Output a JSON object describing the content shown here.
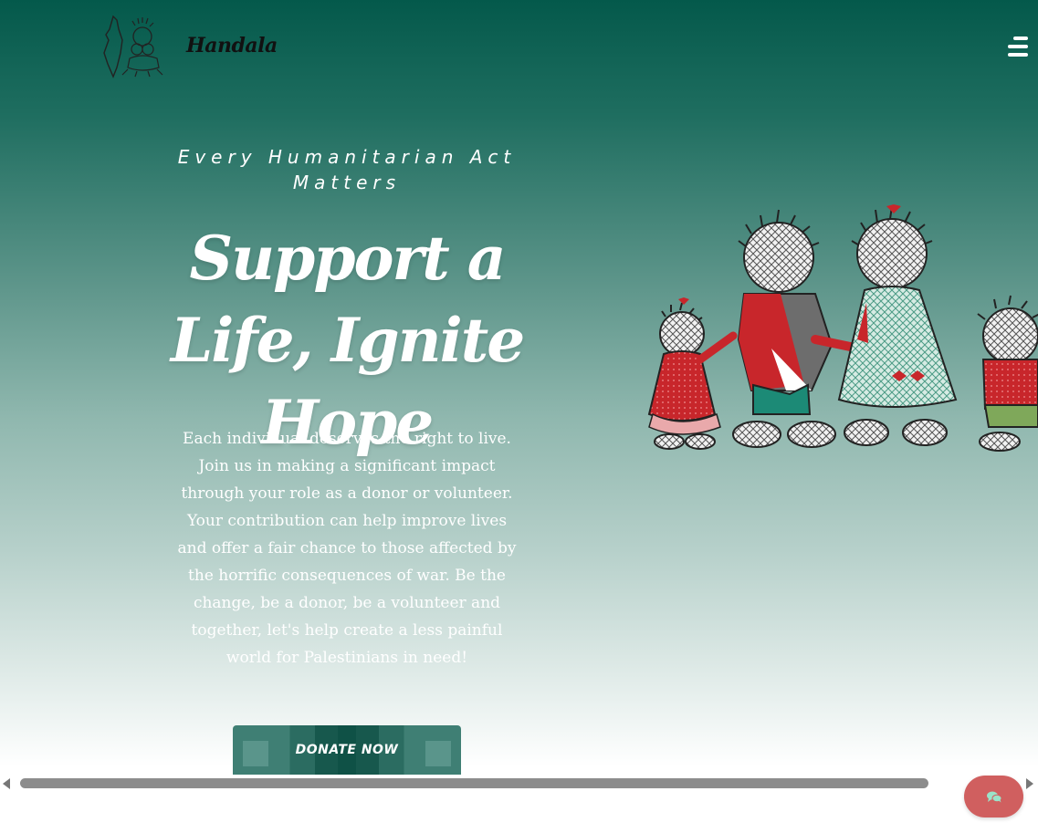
{
  "header": {
    "brand": "Handala",
    "logo_icon": "handala-map-logo-icon",
    "menu_icon": "hamburger-menu-icon"
  },
  "hero": {
    "tagline": "Every Humanitarian Act Matters",
    "headline": "Support a Life, Ignite Hope",
    "body": "Each individual deserves the right to live. Join us in making a significant impact through your role as a donor or volunteer. Your contribution can help improve lives and offer a fair chance to those affected by the horrific consequences of war. Be the change, be a donor, be a volunteer and together, let's help create a less painful world for Palestinians in need!",
    "donate_label": "DONATE NOW"
  },
  "chat": {
    "icon": "chat-bubbles-icon"
  },
  "colors": {
    "gradient_top": "#04594b",
    "donate_dark": "#0f5146",
    "chat_button": "#d05f5f",
    "chat_icon": "#9be3c9",
    "text_light": "#ffffff"
  }
}
